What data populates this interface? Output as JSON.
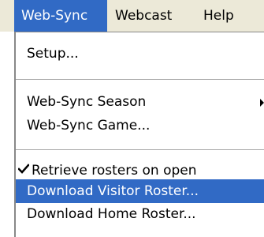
{
  "menubar": {
    "items": [
      {
        "label": "Web-Sync"
      },
      {
        "label": "Webcast"
      },
      {
        "label": "Help"
      }
    ]
  },
  "dropdown": {
    "items": [
      {
        "label": "Setup..."
      },
      {
        "label": "Web-Sync Season"
      },
      {
        "label": "Web-Sync Game..."
      },
      {
        "label": "Retrieve rosters on open"
      },
      {
        "label": "Download Visitor Roster..."
      },
      {
        "label": "Download Home Roster..."
      }
    ]
  }
}
